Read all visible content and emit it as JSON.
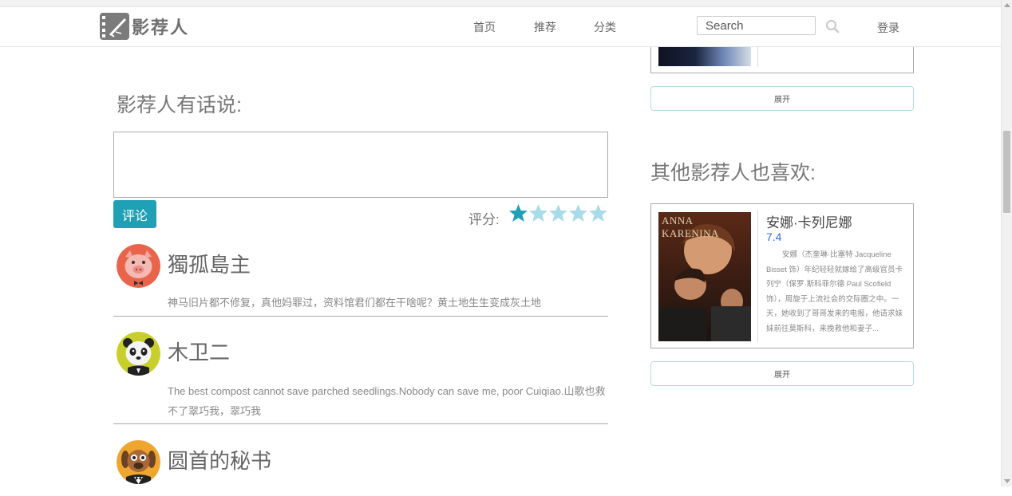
{
  "nav": {
    "logo_text": "影荐人",
    "links": [
      "首页",
      "推荐",
      "分类"
    ],
    "search_placeholder": "Search",
    "login_label": "登录"
  },
  "comment_section": {
    "heading": "影荐人有话说:",
    "submit_label": "评论",
    "rating_label": "评分:",
    "rating_value": 1,
    "rating_max": 5,
    "star_color_active": "#1fa0b5",
    "star_color_inactive": "#a9dbe8"
  },
  "comments": [
    {
      "user": "獨孤島主",
      "avatar": "pig-avatar-icon",
      "text": "神马旧片都不修复，真他妈罪过，资料馆君们都在干啥呢？黄土地生生变成灰土地"
    },
    {
      "user": "木卫二",
      "avatar": "panda-avatar-icon",
      "text": "The best compost cannot save parched seedlings.Nobody can save me, poor Cuiqiao.山歌也救不了翠巧我，翠巧我"
    },
    {
      "user": "圆首的秘书",
      "avatar": "dog-avatar-icon",
      "text": ""
    }
  ],
  "sidebar": {
    "expand_label_1": "展开",
    "heading": "其他影荐人也喜欢:",
    "movie": {
      "title": "安娜·卡列尼娜",
      "score": "7.4",
      "poster_title": "ANNA KARENINA",
      "description": "安娜（杰奎琳·比塞特 Jacqueline Bisset 饰）年纪轻轻就嫁给了高级官员卡列宁（保罗·斯科菲尔德 Paul Scofield 饰），周旋于上流社会的交际圈之中。一天，她收到了哥哥发来的电报，他请求妹妹前往莫斯科，来挽救他和妻子..."
    },
    "expand_label_2": "展开"
  }
}
